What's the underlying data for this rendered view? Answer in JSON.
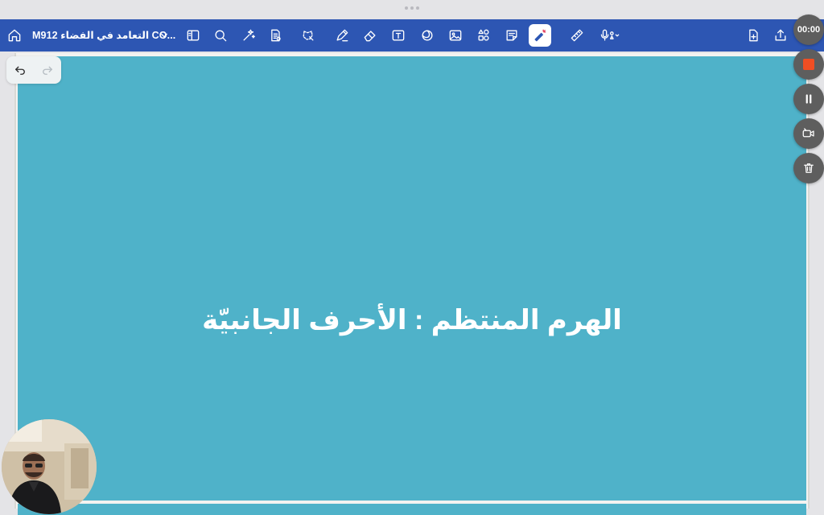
{
  "toolbar": {
    "document_title": "‏M912 التعامد في الفضاء CO...",
    "background_color": "#2d56b3",
    "icons": [
      "home-icon",
      "chevron-down-icon",
      "sidebar-icon",
      "search-icon",
      "sparkle-icon",
      "document-icon",
      "lasso-icon",
      "pen-icon",
      "eraser-icon",
      "text-box-icon",
      "shape-icon",
      "image-icon",
      "elements-icon",
      "sticky-note-icon",
      "laser-pointer-icon",
      "ruler-icon",
      "microphone-icon",
      "add-page-icon",
      "share-icon"
    ]
  },
  "slide": {
    "title": "الهرم المنتظم : الأحرف الجانبيّة",
    "background_color": "#4fb2c9"
  },
  "recording": {
    "timer": "00:00",
    "stop_color": "#f04e23"
  },
  "history": {
    "undo_enabled": true,
    "redo_enabled": false
  }
}
